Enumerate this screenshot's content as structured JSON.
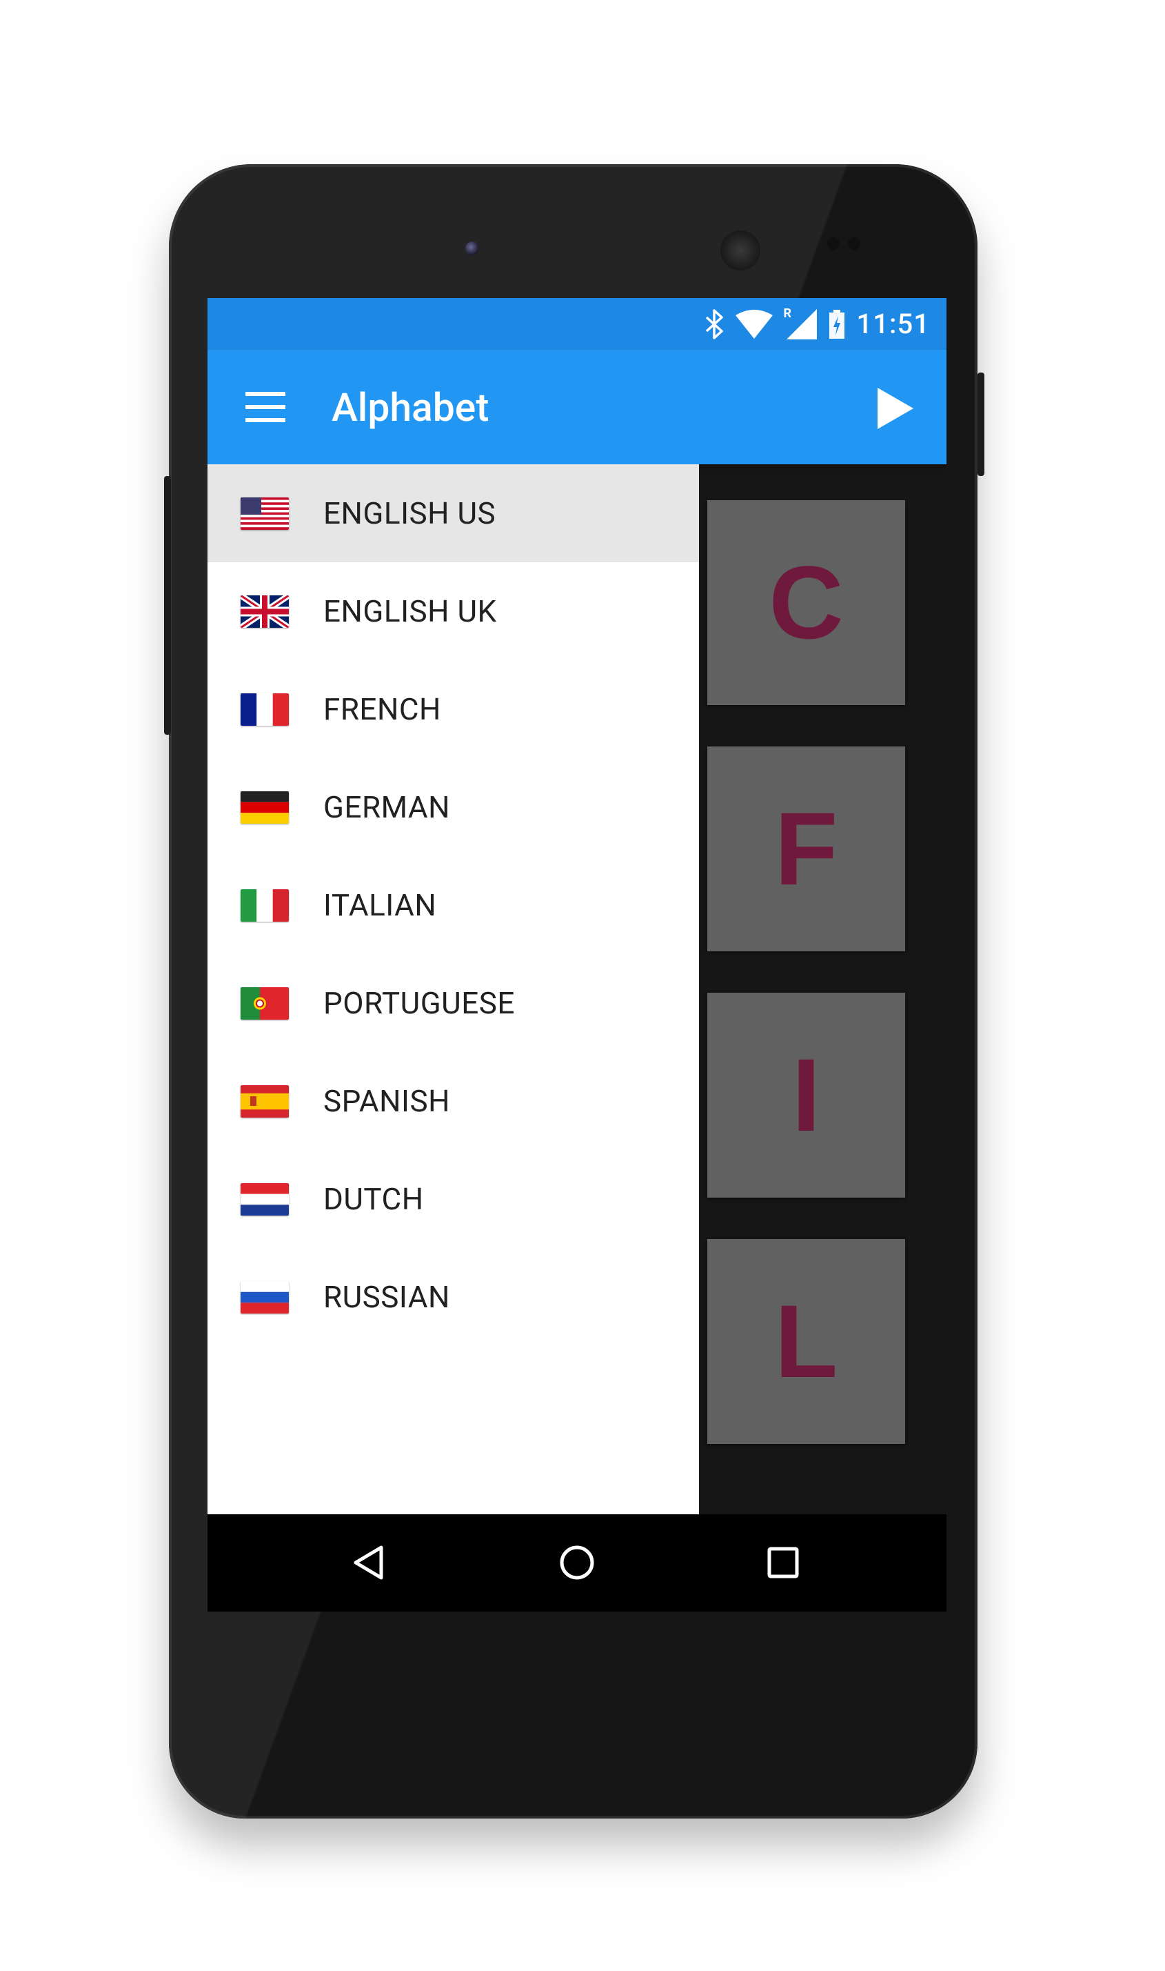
{
  "status_bar": {
    "time": "11:51",
    "icons": [
      "bluetooth-icon",
      "wifi-icon",
      "signal-icon",
      "battery-charging-icon"
    ],
    "roaming_indicator": "R"
  },
  "toolbar": {
    "title": "Alphabet",
    "menu_icon": "hamburger-icon",
    "action_icon": "play-icon",
    "color": "#2196f3"
  },
  "drawer": {
    "items": [
      {
        "label": "ENGLISH US",
        "flag": "us-flag-icon",
        "selected": true
      },
      {
        "label": "ENGLISH UK",
        "flag": "uk-flag-icon",
        "selected": false
      },
      {
        "label": "FRENCH",
        "flag": "france-flag-icon",
        "selected": false
      },
      {
        "label": "GERMAN",
        "flag": "germany-flag-icon",
        "selected": false
      },
      {
        "label": "ITALIAN",
        "flag": "italy-flag-icon",
        "selected": false
      },
      {
        "label": "PORTUGUESE",
        "flag": "portugal-flag-icon",
        "selected": false
      },
      {
        "label": "SPANISH",
        "flag": "spain-flag-icon",
        "selected": false
      },
      {
        "label": "DUTCH",
        "flag": "netherlands-flag-icon",
        "selected": false
      },
      {
        "label": "RUSSIAN",
        "flag": "russia-flag-icon",
        "selected": false
      }
    ]
  },
  "tiles": {
    "letters": [
      "C",
      "F",
      "I",
      "L"
    ],
    "tile_color": "#616161",
    "letter_color": "#6f1a3c"
  },
  "nav_bar": {
    "icons": [
      "back-icon",
      "home-icon",
      "recents-icon"
    ]
  }
}
